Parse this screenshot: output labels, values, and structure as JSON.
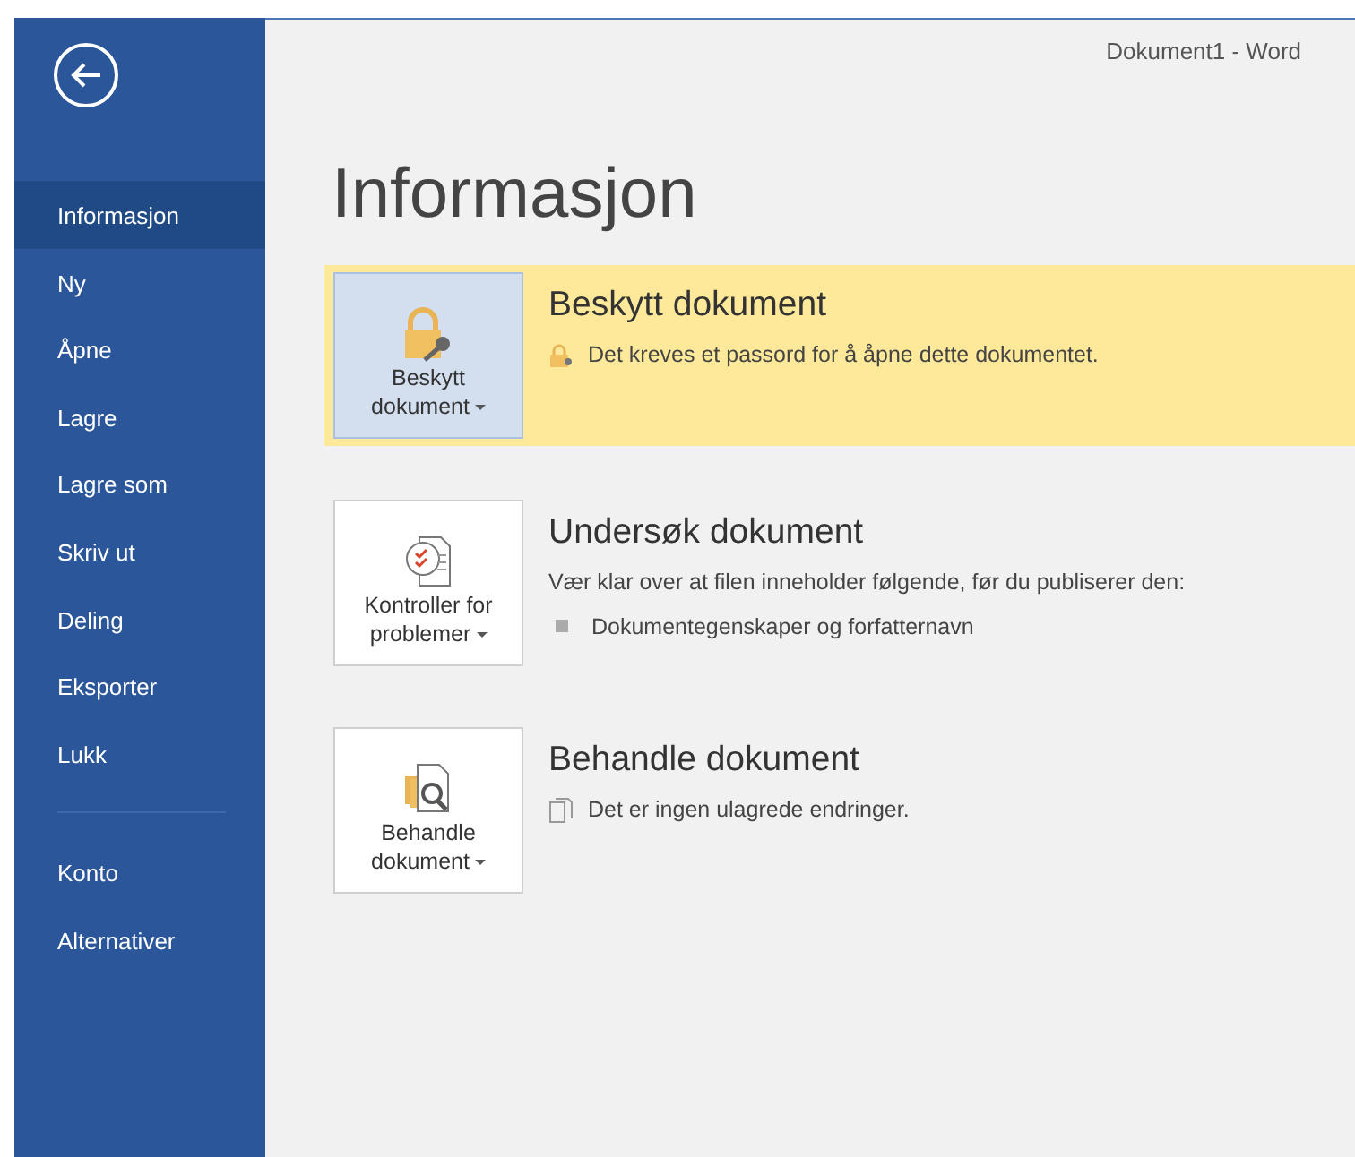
{
  "window": {
    "title": "Dokument1 - Word"
  },
  "sidebar": {
    "items": [
      {
        "label": "Informasjon",
        "selected": true
      },
      {
        "label": "Ny",
        "selected": false
      },
      {
        "label": "Åpne",
        "selected": false
      },
      {
        "label": "Lagre",
        "selected": false
      },
      {
        "label": "Lagre som",
        "selected": false
      },
      {
        "label": "Skriv ut",
        "selected": false
      },
      {
        "label": "Deling",
        "selected": false
      },
      {
        "label": "Eksporter",
        "selected": false
      },
      {
        "label": "Lukk",
        "selected": false
      },
      {
        "kind": "separator"
      },
      {
        "label": "Konto",
        "selected": false
      },
      {
        "label": "Alternativer",
        "selected": false
      }
    ]
  },
  "page_title": "Informasjon",
  "sections": [
    {
      "highlighted": true,
      "kind": "lock",
      "button_lines": [
        "Beskytt",
        "dokument"
      ],
      "heading": "Beskytt dokument",
      "details": [
        {
          "kind": "lock",
          "text": "Det kreves et passord for å åpne dette dokumentet."
        }
      ]
    },
    {
      "highlighted": false,
      "kind": "checklist",
      "button_lines": [
        "Kontroller for",
        "problemer"
      ],
      "heading": "Undersøk dokument",
      "details": [
        {
          "kind": "plain",
          "text": "Vær klar over at filen inneholder følgende, før du publiserer den:"
        },
        {
          "kind": "bullet",
          "text": "Dokumentegenskaper og forfatternavn"
        }
      ]
    },
    {
      "highlighted": false,
      "kind": "pages",
      "button_lines": [
        "Behandle",
        "dokument"
      ],
      "heading": "Behandle dokument",
      "details": [
        {
          "kind": "page",
          "text": "Det er ingen ulagrede endringer."
        }
      ]
    }
  ]
}
